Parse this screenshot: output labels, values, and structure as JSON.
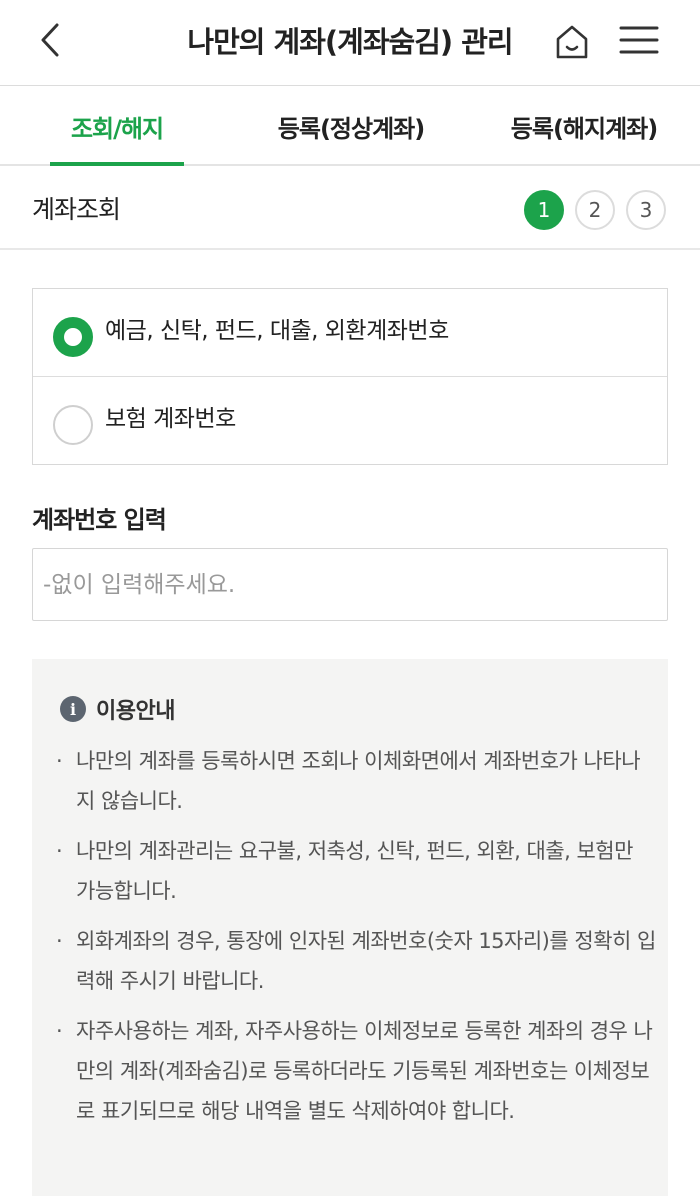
{
  "header": {
    "title": "나만의 계좌(계좌숨김) 관리",
    "back_icon": "chevron-left-icon",
    "home_icon": "home-icon",
    "menu_icon": "hamburger-menu-icon"
  },
  "tabs": [
    {
      "label": "조회/해지",
      "active": true
    },
    {
      "label": "등록(정상계좌)",
      "active": false
    },
    {
      "label": "등록(해지계좌)",
      "active": false
    }
  ],
  "step_section": {
    "title": "계좌조회",
    "steps": [
      "1",
      "2",
      "3"
    ],
    "current_step": 1
  },
  "account_type": {
    "options": [
      {
        "label": "예금, 신탁, 펀드, 대출, 외환계좌번호",
        "selected": true
      },
      {
        "label": "보험 계좌번호",
        "selected": false
      }
    ]
  },
  "account_input": {
    "label": "계좌번호 입력",
    "placeholder": "-없이 입력해주세요.",
    "value": ""
  },
  "guide": {
    "title": "이용안내",
    "items": [
      "나만의 계좌를 등록하시면 조회나 이체화면에서 계좌번호가 나타나지 않습니다.",
      "나만의 계좌관리는 요구불, 저축성, 신탁, 펀드, 외환, 대출, 보험만 가능합니다.",
      "외화계좌의 경우, 통장에 인자된 계좌번호(숫자 15자리)를 정확히 입력해 주시기 바랍니다.",
      "자주사용하는 계좌, 자주사용하는 이체정보로 등록한 계좌의 경우 나만의 계좌(계좌숨김)로 등록하더라도 기등록된 계좌번호는 이체정보로 표기되므로 해당 내역을 별도 삭제하여야 합니다."
    ]
  },
  "colors": {
    "accent": "#1ca34b",
    "guide_background": "#f4f4f3"
  }
}
